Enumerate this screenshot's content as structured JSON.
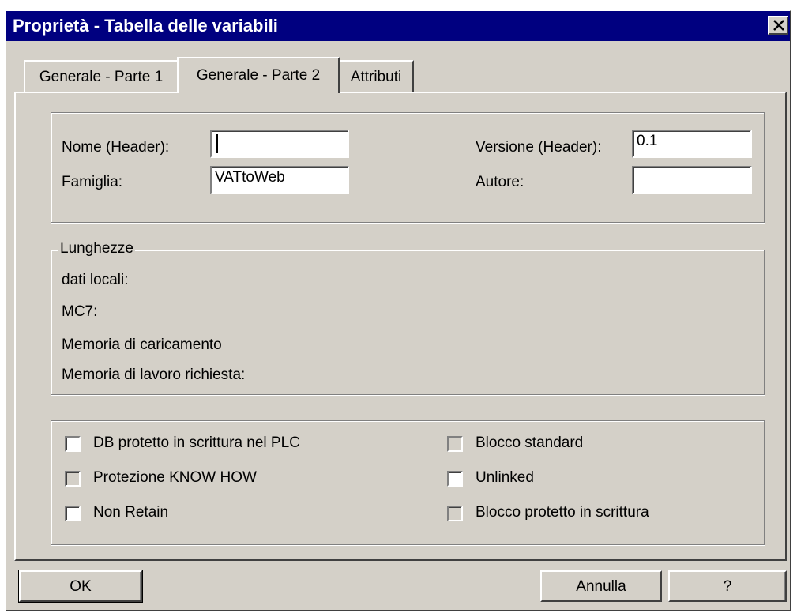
{
  "window": {
    "title": "Proprietà - Tabella delle variabili"
  },
  "tabs": [
    {
      "label": "Generale - Parte 1",
      "active": false
    },
    {
      "label": "Generale - Parte 2",
      "active": true
    },
    {
      "label": "Attributi",
      "active": false
    }
  ],
  "header": {
    "nome_label": "Nome (Header):",
    "nome_value": "",
    "famiglia_label": "Famiglia:",
    "famiglia_value": "VATtoWeb",
    "versione_label": "Versione (Header):",
    "versione_value": "0.1",
    "autore_label": "Autore:",
    "autore_value": ""
  },
  "lengths": {
    "title": "Lunghezze",
    "items": [
      "dati locali:",
      "MC7:",
      "Memoria di caricamento",
      "Memoria di lavoro richiesta:"
    ]
  },
  "options": [
    {
      "label": "DB protetto in scrittura nel PLC",
      "checked": false,
      "enabled": true
    },
    {
      "label": "Protezione KNOW HOW",
      "checked": false,
      "enabled": false
    },
    {
      "label": "Non Retain",
      "checked": false,
      "enabled": true
    },
    {
      "label": "Blocco standard",
      "checked": false,
      "enabled": false
    },
    {
      "label": "Unlinked",
      "checked": false,
      "enabled": true
    },
    {
      "label": "Blocco protetto in scrittura",
      "checked": false,
      "enabled": false
    }
  ],
  "buttons": {
    "ok": "OK",
    "cancel": "Annulla",
    "help": "?"
  },
  "icons": {
    "close": "close-icon"
  },
  "colors": {
    "titlebar": "#000080",
    "face": "#d4d0c8"
  }
}
